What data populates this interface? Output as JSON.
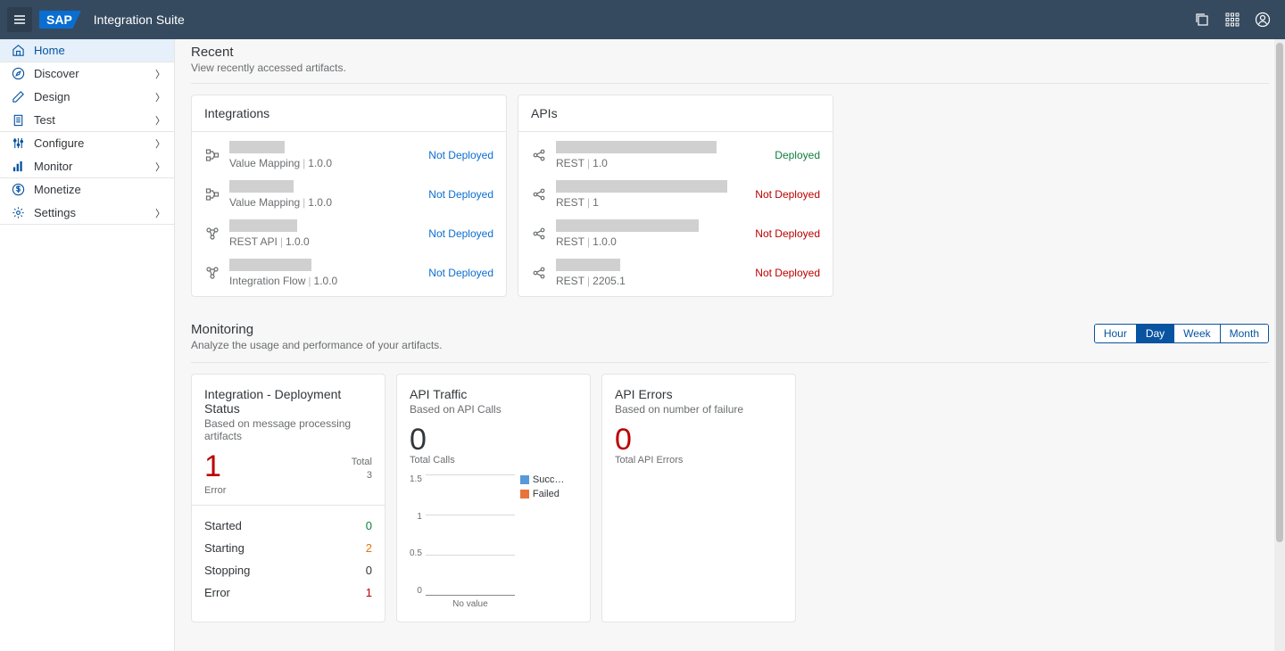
{
  "header": {
    "logo_text": "SAP",
    "title": "Integration Suite"
  },
  "sidebar": {
    "items": [
      {
        "label": "Home",
        "icon": "home",
        "active": true,
        "chevron": false
      },
      {
        "label": "Discover",
        "icon": "compass",
        "active": false,
        "chevron": true
      },
      {
        "label": "Design",
        "icon": "pencil",
        "active": false,
        "chevron": true
      },
      {
        "label": "Test",
        "icon": "clipboard",
        "active": false,
        "chevron": true
      },
      {
        "label": "Configure",
        "icon": "sliders",
        "active": false,
        "chevron": true
      },
      {
        "label": "Monitor",
        "icon": "bars",
        "active": false,
        "chevron": true
      },
      {
        "label": "Monetize",
        "icon": "dollar",
        "active": false,
        "chevron": false
      },
      {
        "label": "Settings",
        "icon": "gear",
        "active": false,
        "chevron": true
      }
    ]
  },
  "recent": {
    "title": "Recent",
    "subtitle": "View recently accessed artifacts.",
    "integrations": {
      "title": "Integrations",
      "items": [
        {
          "name_width": 62,
          "type": "Value Mapping",
          "version": "1.0.0",
          "status": "Not Deployed",
          "status_class": "st-notdeployed-blue",
          "icon": "vm"
        },
        {
          "name_width": 72,
          "type": "Value Mapping",
          "version": "1.0.0",
          "status": "Not Deployed",
          "status_class": "st-notdeployed-blue",
          "icon": "vm"
        },
        {
          "name_width": 76,
          "type": "REST API",
          "version": "1.0.0",
          "status": "Not Deployed",
          "status_class": "st-notdeployed-blue",
          "icon": "rest"
        },
        {
          "name_width": 92,
          "type": "Integration Flow",
          "version": "1.0.0",
          "status": "Not Deployed",
          "status_class": "st-notdeployed-blue",
          "icon": "flow"
        }
      ]
    },
    "apis": {
      "title": "APIs",
      "items": [
        {
          "name_width": 180,
          "type": "REST",
          "version": "1.0",
          "status": "Deployed",
          "status_class": "st-deployed",
          "icon": "share"
        },
        {
          "name_width": 192,
          "type": "REST",
          "version": "1",
          "status": "Not Deployed",
          "status_class": "st-notdeployed-red",
          "icon": "share"
        },
        {
          "name_width": 160,
          "type": "REST",
          "version": "1.0.0",
          "status": "Not Deployed",
          "status_class": "st-notdeployed-red",
          "icon": "share"
        },
        {
          "name_width": 72,
          "type": "REST",
          "version": "2205.1",
          "status": "Not Deployed",
          "status_class": "st-notdeployed-red",
          "icon": "share"
        }
      ]
    }
  },
  "monitoring": {
    "title": "Monitoring",
    "subtitle": "Analyze the usage and performance of your artifacts.",
    "time_options": [
      "Hour",
      "Day",
      "Week",
      "Month"
    ],
    "time_selected": 1,
    "deployment": {
      "title": "Integration - Deployment Status",
      "subtitle": "Based on message processing artifacts",
      "big_value": "1",
      "big_label": "Error",
      "total_label": "Total",
      "total_value": "3",
      "rows": [
        {
          "label": "Started",
          "value": "0",
          "class": "v-green"
        },
        {
          "label": "Starting",
          "value": "2",
          "class": "v-orange"
        },
        {
          "label": "Stopping",
          "value": "0",
          "class": "v-def"
        },
        {
          "label": "Error",
          "value": "1",
          "class": "v-red"
        }
      ]
    },
    "traffic": {
      "title": "API Traffic",
      "subtitle": "Based on API Calls",
      "big_value": "0",
      "big_label": "Total Calls",
      "legend": [
        {
          "label": "Succ…",
          "swatch": "sw-blue"
        },
        {
          "label": "Failed",
          "swatch": "sw-orange"
        }
      ],
      "x_label": "No value"
    },
    "errors": {
      "title": "API Errors",
      "subtitle": "Based on number of failure",
      "big_value": "0",
      "big_label": "Total API Errors"
    }
  },
  "chart_data": {
    "type": "bar",
    "title": "API Traffic",
    "xlabel": "No value",
    "ylabel": "",
    "ylim": [
      0,
      1.5
    ],
    "y_ticks": [
      1.5,
      1,
      0.5,
      0
    ],
    "categories": [],
    "series": [
      {
        "name": "Succ…",
        "values": []
      },
      {
        "name": "Failed",
        "values": []
      }
    ]
  }
}
